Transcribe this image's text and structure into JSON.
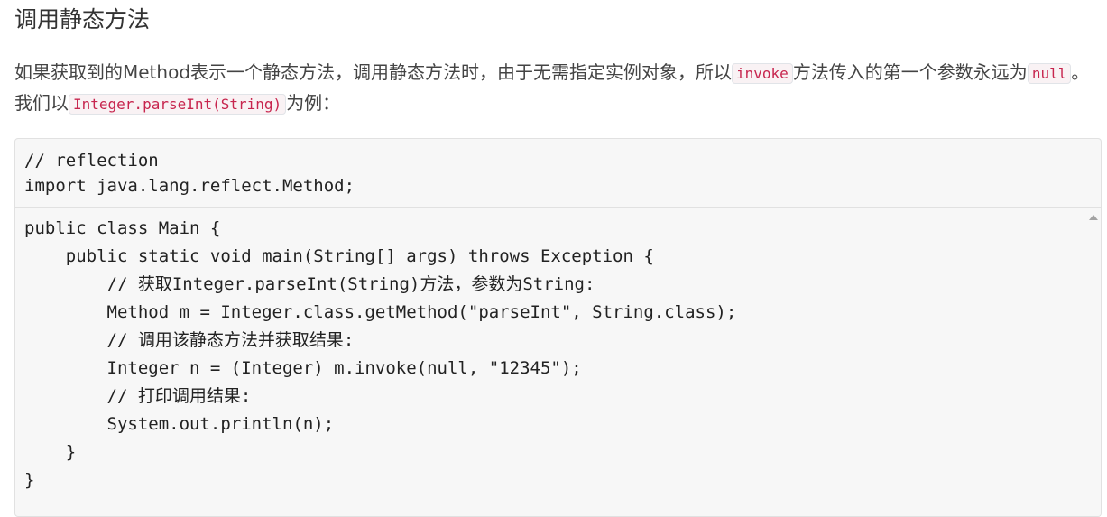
{
  "heading": "调用静态方法",
  "paragraph": {
    "part1": "如果获取到的Method表示一个静态方法，调用静态方法时，由于无需指定实例对象，所以",
    "code1": "invoke",
    "part2": "方法传入的第一个参数永远为",
    "code2": "null",
    "part3": "。我们以",
    "code3": "Integer.parseInt(String)",
    "part4": "为例："
  },
  "code_header": [
    "// reflection",
    "import java.lang.reflect.Method;"
  ],
  "code_body": [
    "public class Main {",
    "    public static void main(String[] args) throws Exception {",
    "        // 获取Integer.parseInt(String)方法，参数为String:",
    "        Method m = Integer.class.getMethod(\"parseInt\", String.class);",
    "        // 调用该静态方法并获取结果:",
    "        Integer n = (Integer) m.invoke(null, \"12345\");",
    "        // 打印调用结果:",
    "        System.out.println(n);",
    "    }",
    "}"
  ]
}
